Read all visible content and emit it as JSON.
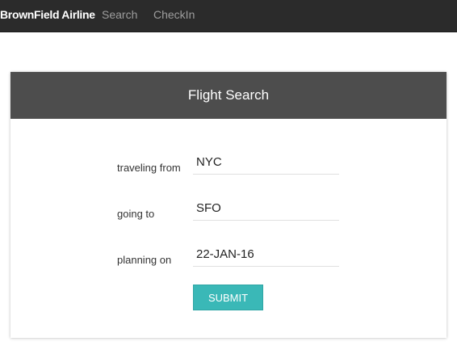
{
  "navbar": {
    "brand": "BrownField Airline",
    "links": [
      {
        "label": "Search"
      },
      {
        "label": "CheckIn"
      }
    ]
  },
  "panel": {
    "title": "Flight Search",
    "fields": [
      {
        "label": "traveling from",
        "value": "NYC"
      },
      {
        "label": "going to",
        "value": "SFO"
      },
      {
        "label": "planning on",
        "value": "22-JAN-16"
      }
    ],
    "submit_label": "SUBMIT"
  },
  "colors": {
    "navbar_bg": "#2b2b2b",
    "panel_header_bg": "#4d4d4d",
    "accent": "#3ab8b7"
  }
}
